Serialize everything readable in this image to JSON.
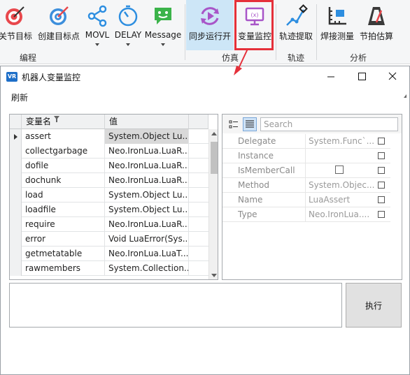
{
  "ribbon": {
    "buttons": [
      {
        "label": "关节目标",
        "icon": "target-icon"
      },
      {
        "label": "创建目标点",
        "icon": "target-icon"
      },
      {
        "label": "MOVL",
        "icon": "share-icon"
      },
      {
        "label": "DELAY",
        "icon": "timer-icon"
      },
      {
        "label": "Message",
        "icon": "message-icon"
      },
      {
        "label": "同步运行开",
        "icon": "sync-icon"
      },
      {
        "label": "变量监控",
        "icon": "monitor-icon"
      },
      {
        "label": "轨迹提取",
        "icon": "trajectory-icon"
      },
      {
        "label": "焊接测量",
        "icon": "ruler-icon"
      },
      {
        "label": "节拍估算",
        "icon": "metronome-icon"
      }
    ],
    "groups": {
      "programming": "编程",
      "simulation": "仿真",
      "trajectory": "轨迹",
      "analysis": "分析"
    },
    "icon_text": "(x)",
    "colors": {
      "active": "#cde6f7",
      "highlight": "#e5303a"
    }
  },
  "window": {
    "title": "机器人变量监控",
    "icon_text": "VR",
    "menu": {
      "refresh": "刷新"
    }
  },
  "grid": {
    "columns": [
      "变量名",
      "值"
    ],
    "rows": [
      {
        "name": "assert",
        "value": "System.Object Lu..."
      },
      {
        "name": "collectgarbage",
        "value": "Neo.IronLua.LuaR..."
      },
      {
        "name": "dofile",
        "value": "Neo.IronLua.LuaR..."
      },
      {
        "name": "dochunk",
        "value": "Neo.IronLua.LuaR..."
      },
      {
        "name": "load",
        "value": "System.Object Lu..."
      },
      {
        "name": "loadfile",
        "value": "System.Object Lu..."
      },
      {
        "name": "require",
        "value": "Neo.IronLua.LuaR..."
      },
      {
        "name": "error",
        "value": "Void LuaError(Sys..."
      },
      {
        "name": "getmetatable",
        "value": "Neo.IronLua.LuaT..."
      },
      {
        "name": "rawmembers",
        "value": "System.Collection..."
      }
    ]
  },
  "property_grid": {
    "search_placeholder": "Search",
    "rows": [
      {
        "name": "Delegate",
        "value": "System.Func`..."
      },
      {
        "name": "Instance",
        "value": ""
      },
      {
        "name": "IsMemberCall",
        "value": ""
      },
      {
        "name": "Method",
        "value": "System.Objec..."
      },
      {
        "name": "Name",
        "value": "LuaAssert"
      },
      {
        "name": "Type",
        "value": "Neo.IronLua...."
      }
    ]
  },
  "execute_button": "执行"
}
